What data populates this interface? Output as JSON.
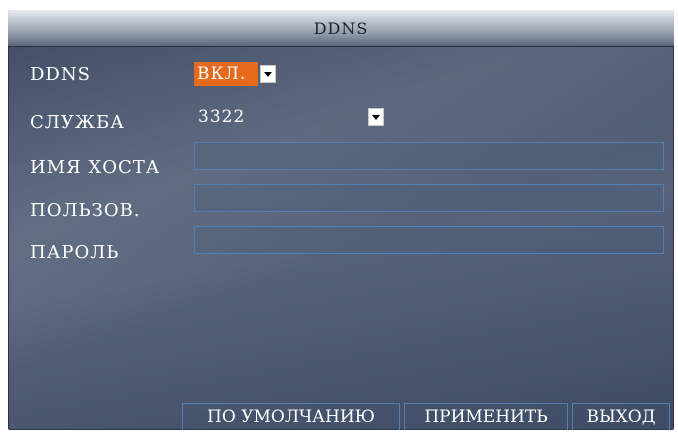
{
  "dialog": {
    "title": "DDNS"
  },
  "form": {
    "ddns_label": "DDNS",
    "ddns_value": "ВКЛ.",
    "service_label": "СЛУЖБА",
    "service_value": "3322",
    "hostname_label": "ИМЯ ХОСТА",
    "hostname_value": "",
    "username_label": "ПОЛЬЗОВ.",
    "username_value": "",
    "password_label": "ПАРОЛЬ",
    "password_value": ""
  },
  "buttons": {
    "default_label": "ПО УМОЛЧАНИЮ",
    "apply_label": "ПРИМЕНИТЬ",
    "exit_label": "ВЫХОД"
  },
  "colors": {
    "accent_selected": "#e56a1c",
    "field_border": "#4f7fb7",
    "background": "#4b5870"
  },
  "icons": {
    "dropdown": "chevron-down-icon"
  }
}
